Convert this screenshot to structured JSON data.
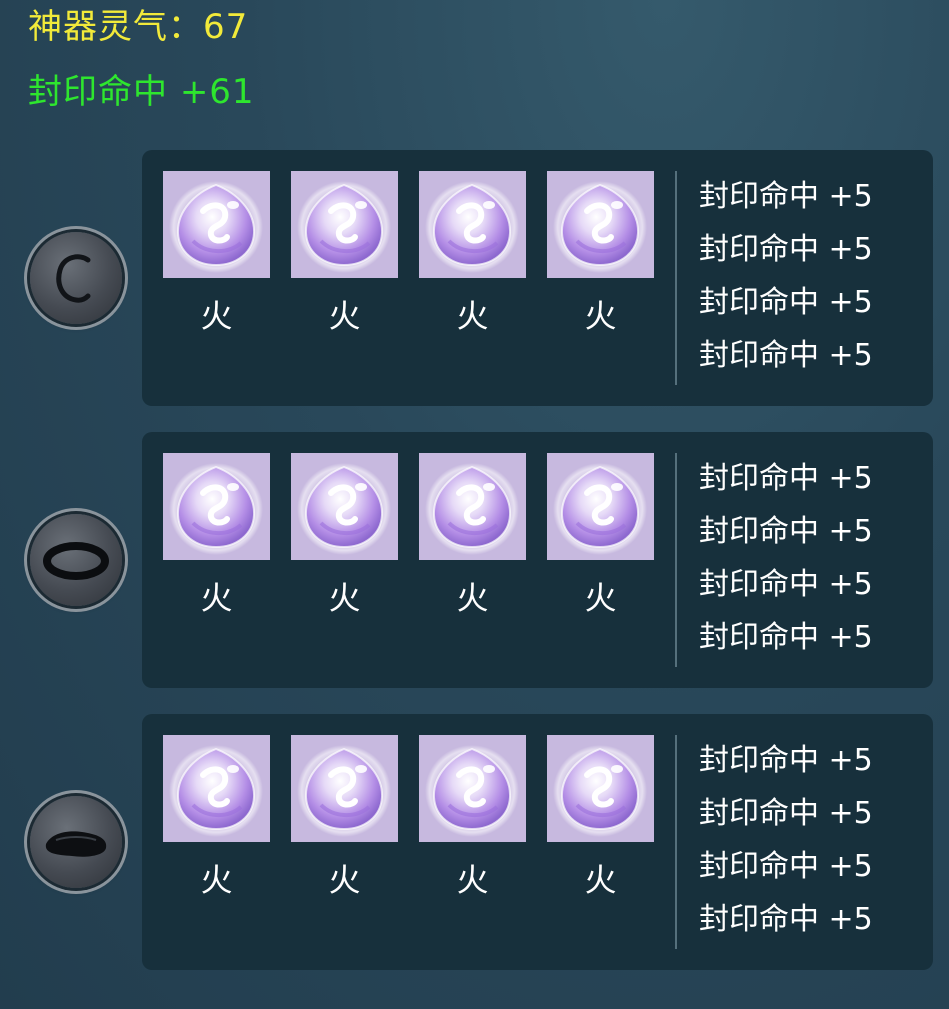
{
  "header": {
    "spirit_label": "神器灵气：",
    "spirit_value": "67",
    "bonus_label": "封印命中",
    "bonus_value": "+61"
  },
  "colors": {
    "spirit_text": "#f2ea3a",
    "bonus_text": "#2ee62e",
    "panel_bg": "#17303c",
    "stone_bg": "#c7b9df"
  },
  "groups": [
    {
      "badge_icon": "ring-c-icon",
      "stones": [
        {
          "icon": "purple-gem-icon",
          "label": "火"
        },
        {
          "icon": "purple-gem-icon",
          "label": "火"
        },
        {
          "icon": "purple-gem-icon",
          "label": "火"
        },
        {
          "icon": "purple-gem-icon",
          "label": "火"
        }
      ],
      "stats": [
        "封印命中 +5",
        "封印命中 +5",
        "封印命中 +5",
        "封印命中 +5"
      ]
    },
    {
      "badge_icon": "bracelet-icon",
      "stones": [
        {
          "icon": "purple-gem-icon",
          "label": "火"
        },
        {
          "icon": "purple-gem-icon",
          "label": "火"
        },
        {
          "icon": "purple-gem-icon",
          "label": "火"
        },
        {
          "icon": "purple-gem-icon",
          "label": "火"
        }
      ],
      "stats": [
        "封印命中 +5",
        "封印命中 +5",
        "封印命中 +5",
        "封印命中 +5"
      ]
    },
    {
      "badge_icon": "dark-stone-icon",
      "stones": [
        {
          "icon": "purple-gem-icon",
          "label": "火"
        },
        {
          "icon": "purple-gem-icon",
          "label": "火"
        },
        {
          "icon": "purple-gem-icon",
          "label": "火"
        },
        {
          "icon": "purple-gem-icon",
          "label": "火"
        }
      ],
      "stats": [
        "封印命中 +5",
        "封印命中 +5",
        "封印命中 +5",
        "封印命中 +5"
      ]
    }
  ]
}
